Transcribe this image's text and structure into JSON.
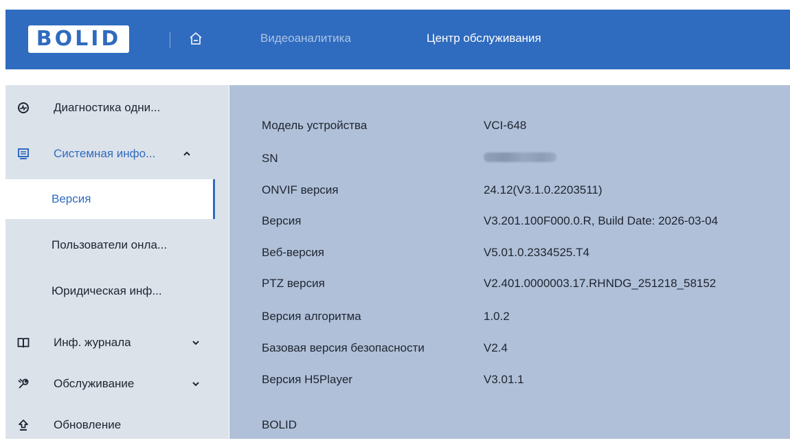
{
  "header": {
    "logo_text": "BOLID",
    "home_icon": "home-icon",
    "tabs": [
      {
        "label": "Видеоаналитика",
        "active": false
      },
      {
        "label": "Центр обслуживания",
        "active": true
      }
    ]
  },
  "sidebar": {
    "items": [
      {
        "label": "Диагностика одни...",
        "icon": "diagnostics-icon"
      },
      {
        "label": "Системная инфо...",
        "icon": "monitor-icon",
        "expanded": true
      },
      {
        "label": "Версия",
        "selected": true
      },
      {
        "label": "Пользователи онла..."
      },
      {
        "label": "Юридическая инф..."
      },
      {
        "label": "Инф. журнала",
        "icon": "book-icon",
        "expanded": false
      },
      {
        "label": "Обслуживание",
        "icon": "wrench-icon",
        "expanded": false
      },
      {
        "label": "Обновление",
        "icon": "upload-icon"
      }
    ]
  },
  "version_info": {
    "rows": [
      {
        "key": "Модель устройства",
        "value": "VCI-648"
      },
      {
        "key": "SN",
        "value": ""
      },
      {
        "key": "ONVIF версия",
        "value": "24.12(V3.1.0.2203511)"
      },
      {
        "key": "Версия",
        "value": "V3.201.100F000.0.R, Build Date: 2026-03-04"
      },
      {
        "key": "Веб-версия",
        "value": "V5.01.0.2334525.T4"
      },
      {
        "key": "PTZ версия",
        "value": "V2.401.0000003.17.RHNDG_251218_58152"
      },
      {
        "key": "Версия алгоритма",
        "value": "1.0.2"
      },
      {
        "key": "Базовая версия безопасности",
        "value": "V2.4"
      },
      {
        "key": "Версия H5Player",
        "value": "V3.01.1"
      }
    ],
    "footer": "BOLID"
  },
  "colors": {
    "header_bg": "#2f6bbf",
    "sidebar_bg": "#dce2ea",
    "content_bg": "#b0c0d8",
    "accent": "#2f6bbf"
  }
}
